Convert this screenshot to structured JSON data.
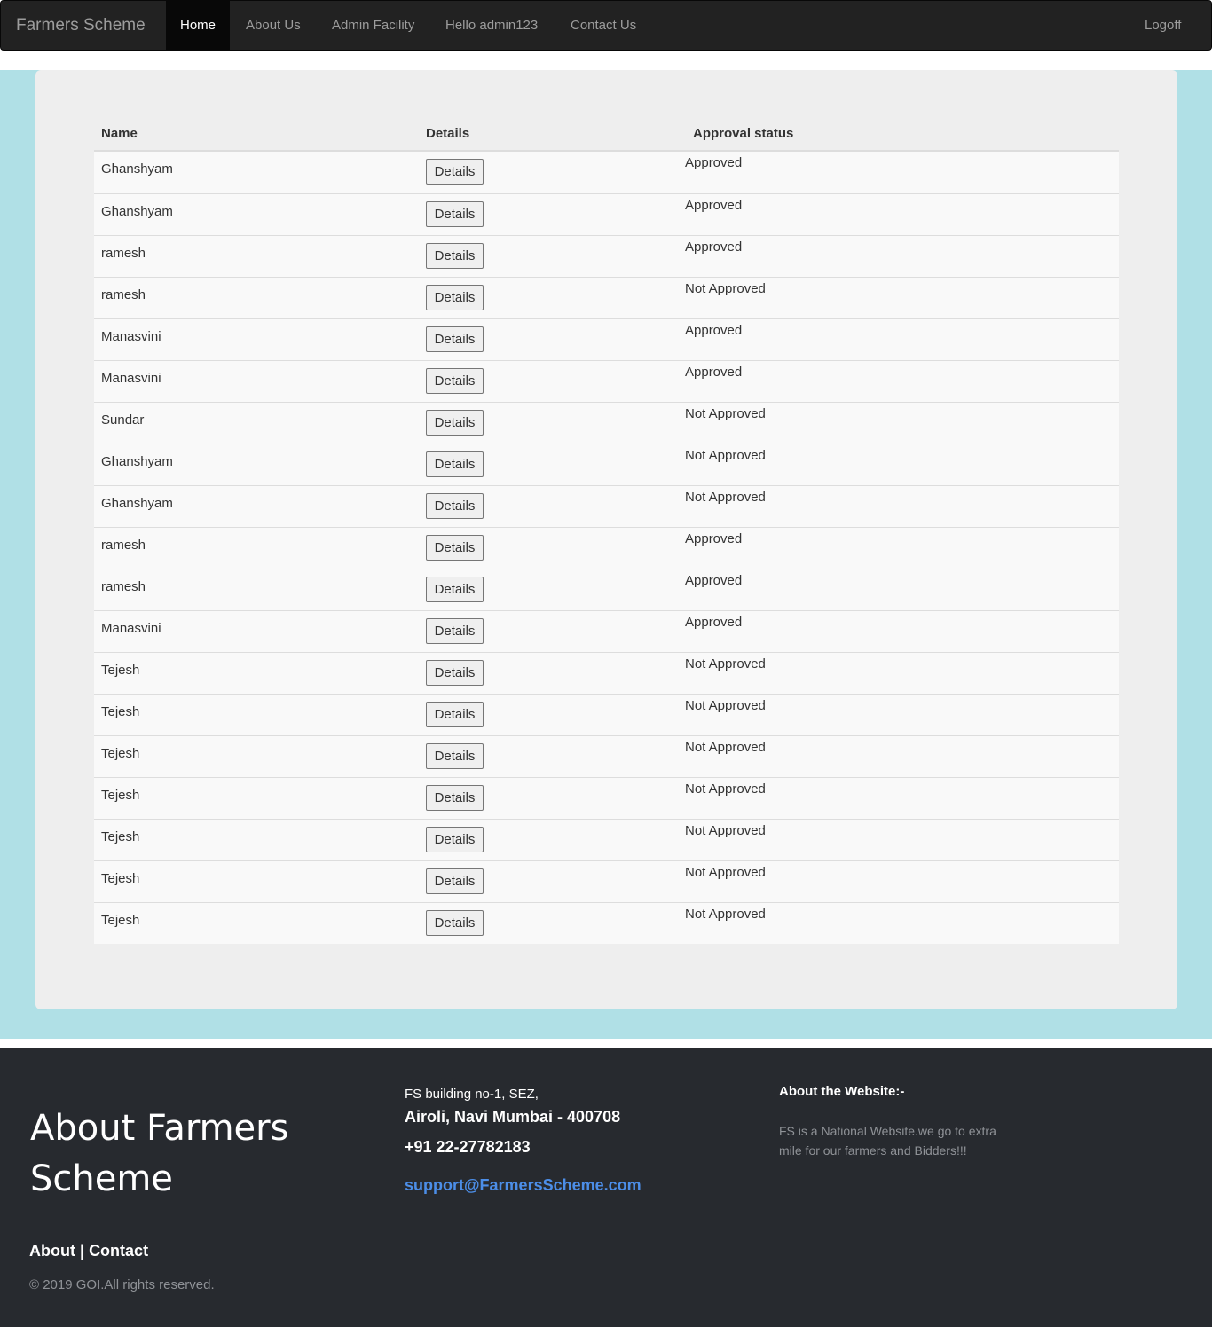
{
  "navbar": {
    "brand": "Farmers Scheme",
    "items": [
      {
        "label": "Home",
        "active": true
      },
      {
        "label": "About Us",
        "active": false
      },
      {
        "label": "Admin Facility",
        "active": false
      },
      {
        "label": "Hello admin123",
        "active": false
      },
      {
        "label": "Contact Us",
        "active": false
      }
    ],
    "logoff": "Logoff"
  },
  "table": {
    "headers": [
      "Name",
      "Details",
      "Approval status"
    ],
    "button_label": "Details",
    "rows": [
      {
        "name": "Ghanshyam",
        "status": "Approved"
      },
      {
        "name": "Ghanshyam",
        "status": "Approved"
      },
      {
        "name": "ramesh",
        "status": "Approved"
      },
      {
        "name": "ramesh",
        "status": "Not Approved"
      },
      {
        "name": "Manasvini",
        "status": "Approved"
      },
      {
        "name": "Manasvini",
        "status": "Approved"
      },
      {
        "name": "Sundar",
        "status": "Not Approved"
      },
      {
        "name": "Ghanshyam",
        "status": "Not Approved"
      },
      {
        "name": "Ghanshyam",
        "status": "Not Approved"
      },
      {
        "name": "ramesh",
        "status": "Approved"
      },
      {
        "name": "ramesh",
        "status": "Approved"
      },
      {
        "name": "Manasvini",
        "status": "Approved"
      },
      {
        "name": "Tejesh",
        "status": "Not Approved"
      },
      {
        "name": "Tejesh",
        "status": "Not Approved"
      },
      {
        "name": "Tejesh",
        "status": "Not Approved"
      },
      {
        "name": "Tejesh",
        "status": "Not Approved"
      },
      {
        "name": "Tejesh",
        "status": "Not Approved"
      },
      {
        "name": "Tejesh",
        "status": "Not Approved"
      },
      {
        "name": "Tejesh",
        "status": "Not Approved"
      }
    ]
  },
  "footer": {
    "title": "About Farmers Scheme",
    "links": {
      "about": "About",
      "separator": "|",
      "contact": "Contact"
    },
    "copyright": "© 2019 GOI.All rights reserved.",
    "address_line1": "FS building no-1, SEZ,",
    "address_line2": "Airoli, Navi Mumbai - 400708",
    "phone": "+91 22-27782183",
    "email": "support@FarmersScheme.com",
    "about_heading": "About the Website:-",
    "about_text": "FS is a National Website.we go to extra mile for our farmers and Bidders!!!"
  },
  "colors": {
    "navbar_bg": "#222222",
    "main_bg": "#b0e0e6",
    "panel_bg": "#eeeeee",
    "footer_bg": "#272a2f",
    "email_link": "#4c8ee8"
  }
}
